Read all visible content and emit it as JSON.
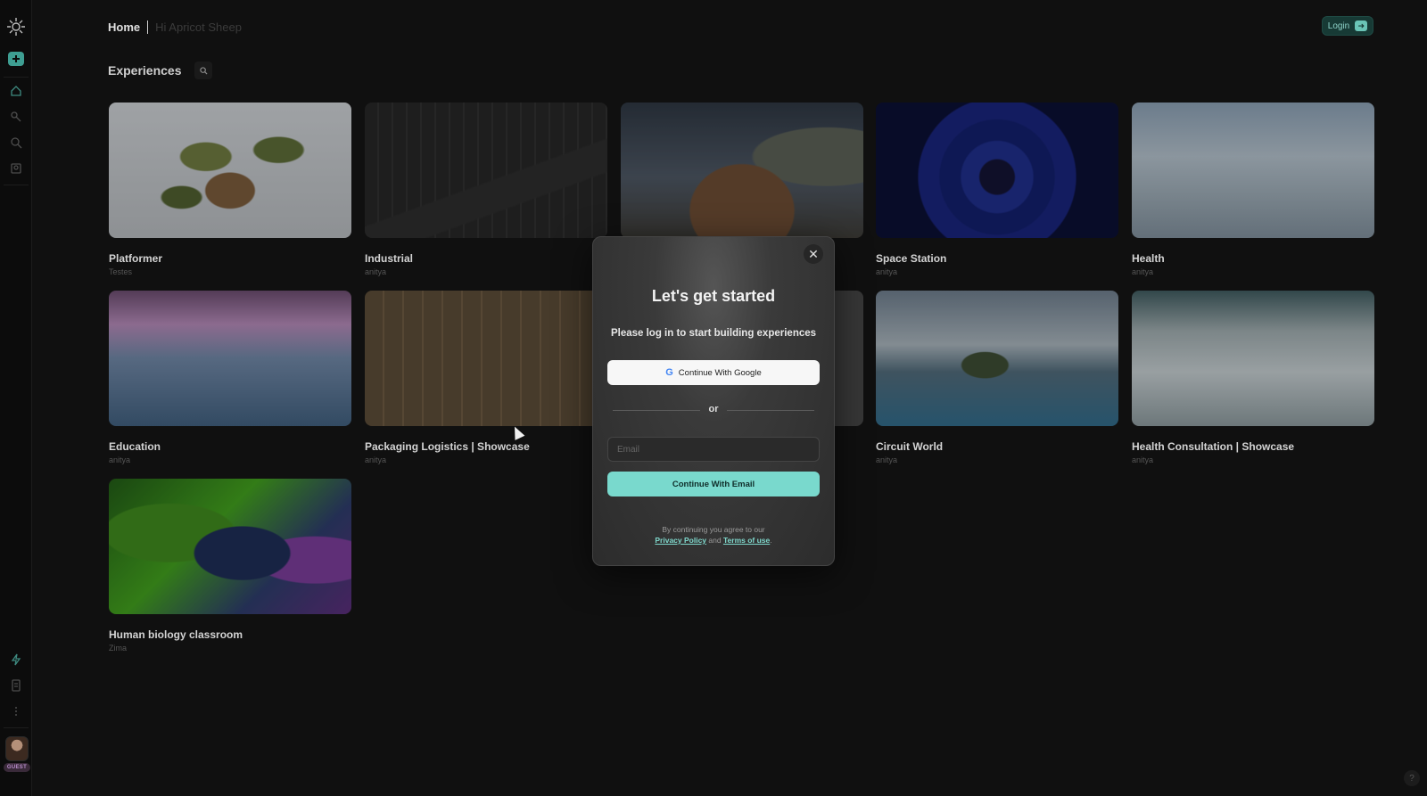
{
  "sidebar": {
    "avatar_badge": "GUEST"
  },
  "header": {
    "breadcrumb_home": "Home",
    "greeting": "Hi Apricot Sheep",
    "login_label": "Login"
  },
  "main": {
    "section_title": "Experiences",
    "cards": [
      {
        "title": "Platformer",
        "author": "Testes"
      },
      {
        "title": "Industrial",
        "author": "anitya"
      },
      {
        "title": "",
        "author": ""
      },
      {
        "title": "Space Station",
        "author": "anitya"
      },
      {
        "title": "Health",
        "author": "anitya"
      },
      {
        "title": "Education",
        "author": "anitya"
      },
      {
        "title": "Packaging Logistics | Showcase",
        "author": "anitya"
      },
      {
        "title": "",
        "author": ""
      },
      {
        "title": "Circuit World",
        "author": "anitya"
      },
      {
        "title": "Health Consultation | Showcase",
        "author": "anitya"
      },
      {
        "title": "Human biology classroom",
        "author": "Zima"
      }
    ]
  },
  "modal": {
    "close_glyph": "✕",
    "title": "Let's get started",
    "subtitle": "Please log in to start building experiences",
    "google_label": "Continue With Google",
    "divider_text": "or",
    "email_placeholder": "Email",
    "email_button_label": "Continue With Email",
    "legal_prefix": "By continuing you agree to our",
    "privacy_label": "Privacy Policy",
    "legal_and": "and",
    "terms_label": "Terms of use",
    "legal_suffix": "."
  },
  "help_label": "?",
  "colors": {
    "accent": "#79d9cd",
    "background": "#101010"
  }
}
